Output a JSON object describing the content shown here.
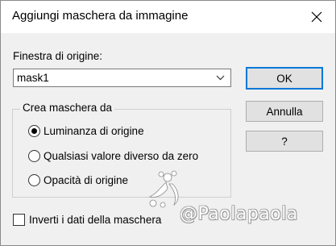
{
  "window": {
    "title": "Aggiungi maschera da immagine"
  },
  "source": {
    "label": "Finestra di origine:",
    "selected": "mask1"
  },
  "buttons": {
    "ok": "OK",
    "cancel": "Annulla",
    "help": "?"
  },
  "group": {
    "title": "Crea maschera da",
    "options": [
      {
        "label": "Luminanza di origine",
        "checked": true
      },
      {
        "label": "Qualsiasi valore diverso da zero",
        "checked": false
      },
      {
        "label": "Opacità di origine",
        "checked": false
      }
    ]
  },
  "invert": {
    "label": "Inverti i dati della maschera",
    "checked": false
  },
  "watermark": {
    "text": "@Paolapaola"
  },
  "icons": [
    "close-icon",
    "chevron-down-icon",
    "floral-ornament-icon"
  ]
}
